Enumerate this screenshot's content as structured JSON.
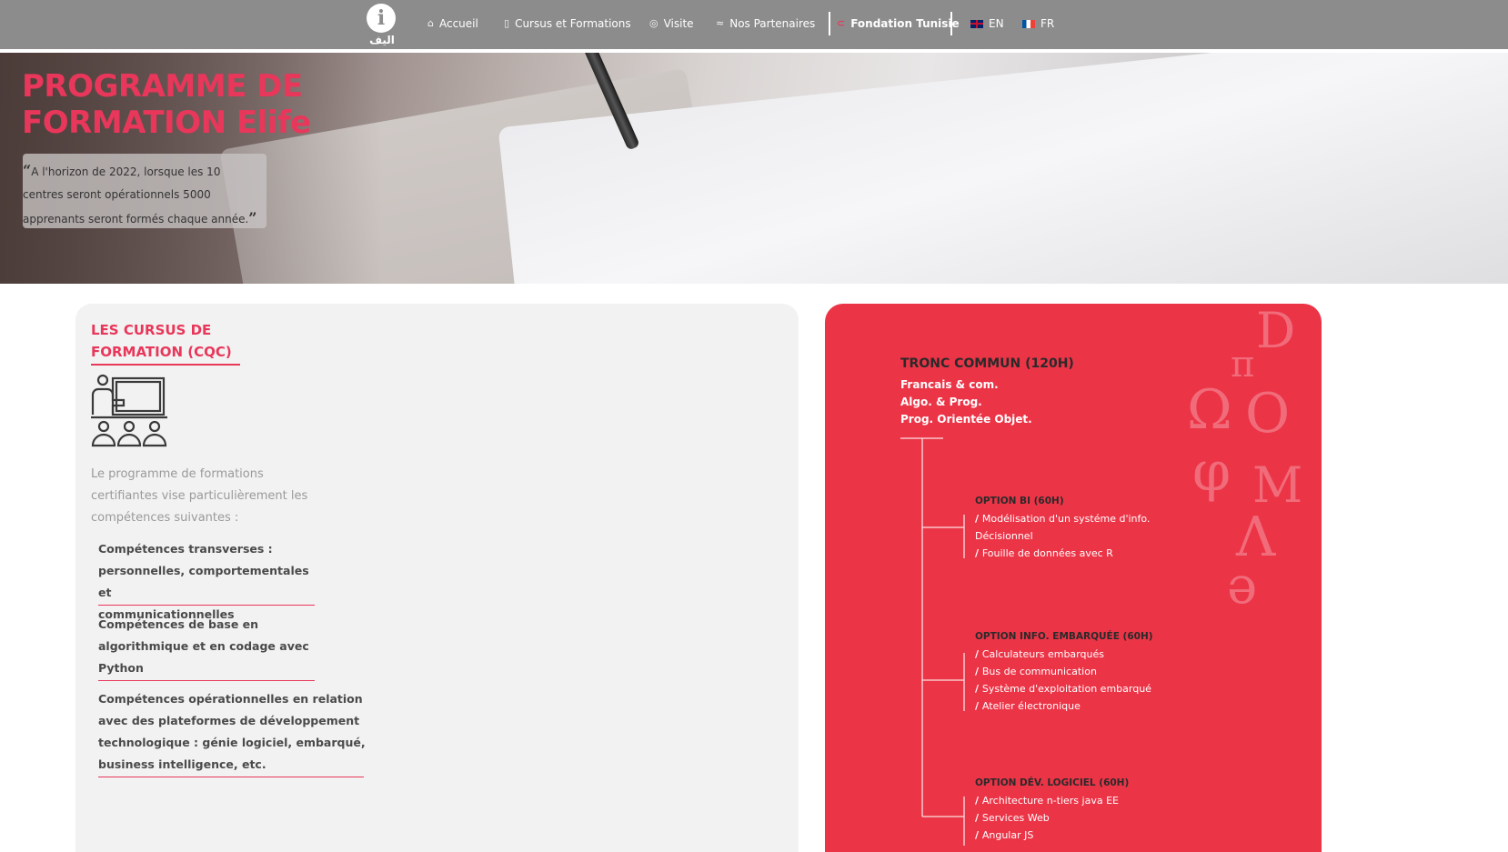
{
  "nav": {
    "logo_text": "اليف",
    "items": [
      {
        "label": "Accueil",
        "icon": "home-icon"
      },
      {
        "label": "Cursus et Formations",
        "icon": "clipboard-icon"
      },
      {
        "label": "Visite",
        "icon": "compass-icon"
      },
      {
        "label": "Nos Partenaires",
        "icon": "handshake-icon"
      },
      {
        "label": "Fondation Tunisie",
        "icon": "link-icon"
      }
    ],
    "languages": [
      {
        "label": "EN",
        "flag": "uk-flag-icon"
      },
      {
        "label": "FR",
        "flag": "fr-flag-icon"
      }
    ],
    "colors": {
      "bar": "#8c8c8c",
      "active_icon": "#e8375a"
    }
  },
  "hero": {
    "title_line1": "PROGRAMME DE",
    "title_line2": "FORMATION Elife",
    "quote": "A l'horizon de 2022, lorsque les 10 centres seront opérationnels 5000 apprenants seront formés chaque année."
  },
  "left": {
    "title_line1": "LES CURSUS DE",
    "title_line2": "FORMATION (CQC)",
    "intro": "Le programme de formations certifiantes vise particulièrement les compétences suivantes :",
    "skills": [
      {
        "lines": [
          "Compétences transverses :",
          "personnelles, comportementales et",
          "communicationnelles"
        ]
      },
      {
        "lines": [
          "Compétences de base en",
          "algorithmique et en codage avec",
          "Python"
        ]
      },
      {
        "lines": [
          "Compétences opérationnelles en relation",
          "avec des plateformes de développement",
          "technologique : génie logiciel, embarqué,",
          "business intelligence, etc."
        ]
      }
    ]
  },
  "right": {
    "title": "TRONC COMMUN (120H)",
    "subjects": [
      "Francais & com.",
      "Algo. & Prog.",
      "Prog. Orientée Objet."
    ],
    "options": [
      {
        "title": "OPTION BI (60H)",
        "items": [
          "Modélisation d'un systéme d'info.",
          " Décisionnel",
          "Fouille de données avec R"
        ]
      },
      {
        "title": "OPTION INFO. EMBARQUÉE (60H)",
        "items": [
          "Calculateurs embarqués",
          "Bus de communication",
          "Système d'exploitation embarqué",
          "Atelier électronique"
        ]
      },
      {
        "title": "OPTION DÉV. LOGICIEL (60H)",
        "items": [
          "Architecture n-tiers java EE",
          "Services Web",
          "Angular JS"
        ]
      }
    ],
    "colors": {
      "card": "#ec3447",
      "accent": "#e8375a"
    }
  }
}
